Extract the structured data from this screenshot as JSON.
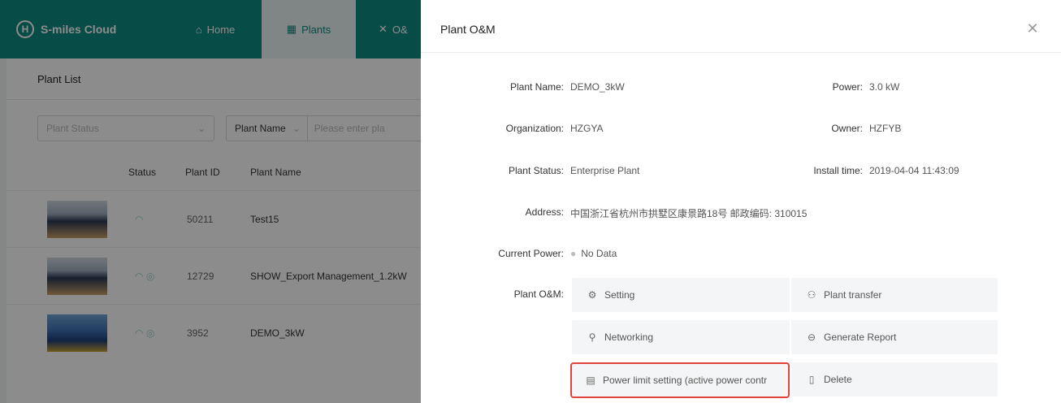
{
  "app": {
    "brand_logo": "H",
    "brand_name": "S-miles Cloud",
    "nav": {
      "home": {
        "icon": "home-icon",
        "label": "Home"
      },
      "plants": {
        "icon": "grid-icon",
        "label": "Plants"
      },
      "om": {
        "icon": "tools-icon",
        "label": "O&"
      }
    }
  },
  "plant_list": {
    "title": "Plant List",
    "status_placeholder": "Plant Status",
    "name_filter_label": "Plant Name",
    "search_placeholder": "Please enter pla",
    "columns": {
      "status": "Status",
      "id": "Plant ID",
      "name": "Plant Name"
    },
    "rows": [
      {
        "id": "50211",
        "name": "Test15",
        "status_icons": "wifi-icon"
      },
      {
        "id": "12729",
        "name": "SHOW_Export Management_1.2kW",
        "status_icons": "wifi-icon check-circle-icon"
      },
      {
        "id": "3952",
        "name": "DEMO_3kW",
        "status_icons": "wifi-icon check-circle-icon"
      }
    ]
  },
  "drawer": {
    "title": "Plant O&M",
    "fields": {
      "plant_name_label": "Plant Name:",
      "plant_name_value": "DEMO_3kW",
      "power_label": "Power:",
      "power_value": "3.0 kW",
      "organization_label": "Organization:",
      "organization_value": "HZGYA",
      "owner_label": "Owner:",
      "owner_value": "HZFYB",
      "plant_status_label": "Plant Status:",
      "plant_status_value": "Enterprise Plant",
      "install_time_label": "Install time:",
      "install_time_value": "2019-04-04 11:43:09",
      "address_label": "Address:",
      "address_value": "中国浙江省杭州市拱墅区康景路18号 邮政编码: 310015",
      "current_power_label": "Current Power:",
      "current_power_value": "No Data",
      "om_label": "Plant O&M:"
    },
    "actions": {
      "setting": "Setting",
      "plant_transfer": "Plant transfer",
      "networking": "Networking",
      "generate_report": "Generate Report",
      "power_limit": "Power limit setting (active power contr",
      "delete": "Delete"
    },
    "highlight_color": "#e0433a"
  },
  "colors": {
    "topbar": "#0e8a80",
    "accent": "#0e8a80"
  }
}
